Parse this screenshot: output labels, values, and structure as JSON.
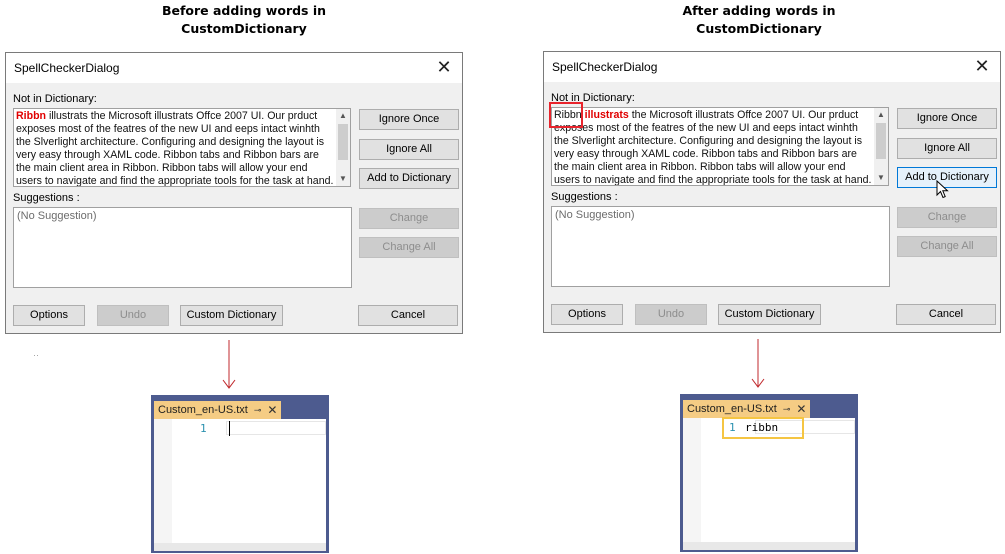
{
  "captions": {
    "before": [
      "Before adding words in",
      "CustomDictionary"
    ],
    "after": [
      "After adding words in",
      "CustomDictionary"
    ]
  },
  "dialog": {
    "title": "SpellCheckerDialog",
    "close_glyph": "✕",
    "not_in_dictionary_label": "Not in Dictionary:",
    "suggestions_label": "Suggestions :",
    "no_suggestion": "(No Suggestion)",
    "text_rest": " the Microsoft illustrats Offce 2007 UI. Our prduct exposes most of the featres of the new UI and eeps intact winhth the Slverlight architecture. Configuring and designing the layout is very easy through XAML code. Ribbon tabs and Ribbon bars are the main client area in Ribbon. Ribbon tabs will allow your end users to navigate and find the appropriate tools for the task at hand.",
    "buttons": {
      "ignore_once": "Ignore Once",
      "ignore_all": "Ignore All",
      "add_to_dictionary": "Add to Dictionary",
      "change": "Change",
      "change_all": "Change All",
      "options": "Options",
      "undo": "Undo",
      "custom_dictionary": "Custom Dictionary",
      "cancel": "Cancel"
    }
  },
  "before": {
    "misspelled_word": "Ribbn",
    "text_rest": " illustrats the Microsoft illustrats Offce 2007 UI. Our prduct exposes most of the featres of the new UI and eeps intact winhth the Slverlight architecture. Configuring and designing the layout is very easy through XAML code. Ribbon tabs and Ribbon bars are the main client area in Ribbon. Ribbon tabs will allow your end users to navigate and find the appropriate tools for the task at hand."
  },
  "after": {
    "added_word": "Ribbn",
    "misspelled_word": "illustrats"
  },
  "editor": {
    "tab_name": "Custom_en-US.txt",
    "pin_glyph": "⊸",
    "close_glyph": "✕",
    "line_number": "1",
    "before_content": "",
    "after_content": "ribbn"
  },
  "colors": {
    "misspelled": "#e00000",
    "highlight_box": "#e8242c",
    "editor_highlight": "#f5c542",
    "arrow": "#c0282c",
    "editor_frame": "#4d5b8f",
    "tab": "#f5cc84"
  }
}
